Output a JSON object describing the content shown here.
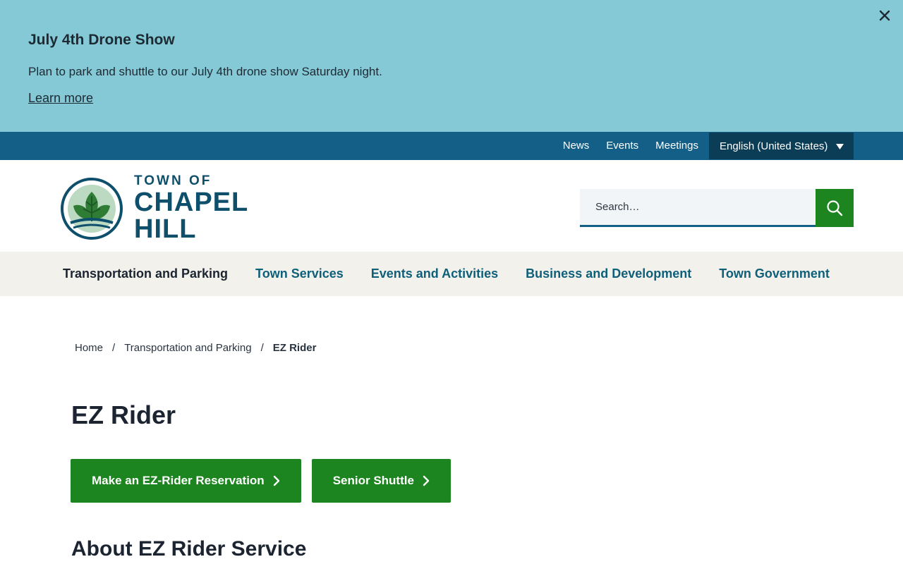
{
  "alert": {
    "title": "July 4th Drone Show",
    "text": "Plan to park and shuttle to our July 4th drone show Saturday night.",
    "link": "Learn more"
  },
  "utility": {
    "links": [
      "News",
      "Events",
      "Meetings"
    ],
    "language": "English (United States)"
  },
  "logo": {
    "line1": "TOWN OF",
    "line2": "CHAPEL",
    "line3": "HILL"
  },
  "search": {
    "placeholder": "Search…"
  },
  "nav": {
    "items": [
      "Transportation and Parking",
      "Town Services",
      "Events and Activities",
      "Business and Development",
      "Town Government"
    ]
  },
  "breadcrumb": {
    "home": "Home",
    "parent": "Transportation and Parking",
    "current": "EZ Rider",
    "separator": "/"
  },
  "page": {
    "title": "EZ Rider",
    "buttons": [
      "Make an EZ-Rider Reservation",
      "Senior Shuttle"
    ],
    "section_title": "About EZ Rider Service"
  },
  "colors": {
    "alert_bg": "#85c9d6",
    "utility_bg": "#135f87",
    "brand_green": "#1d851f",
    "brand_blue": "#0e4f6c",
    "nav_bg": "#f3f1eb"
  }
}
